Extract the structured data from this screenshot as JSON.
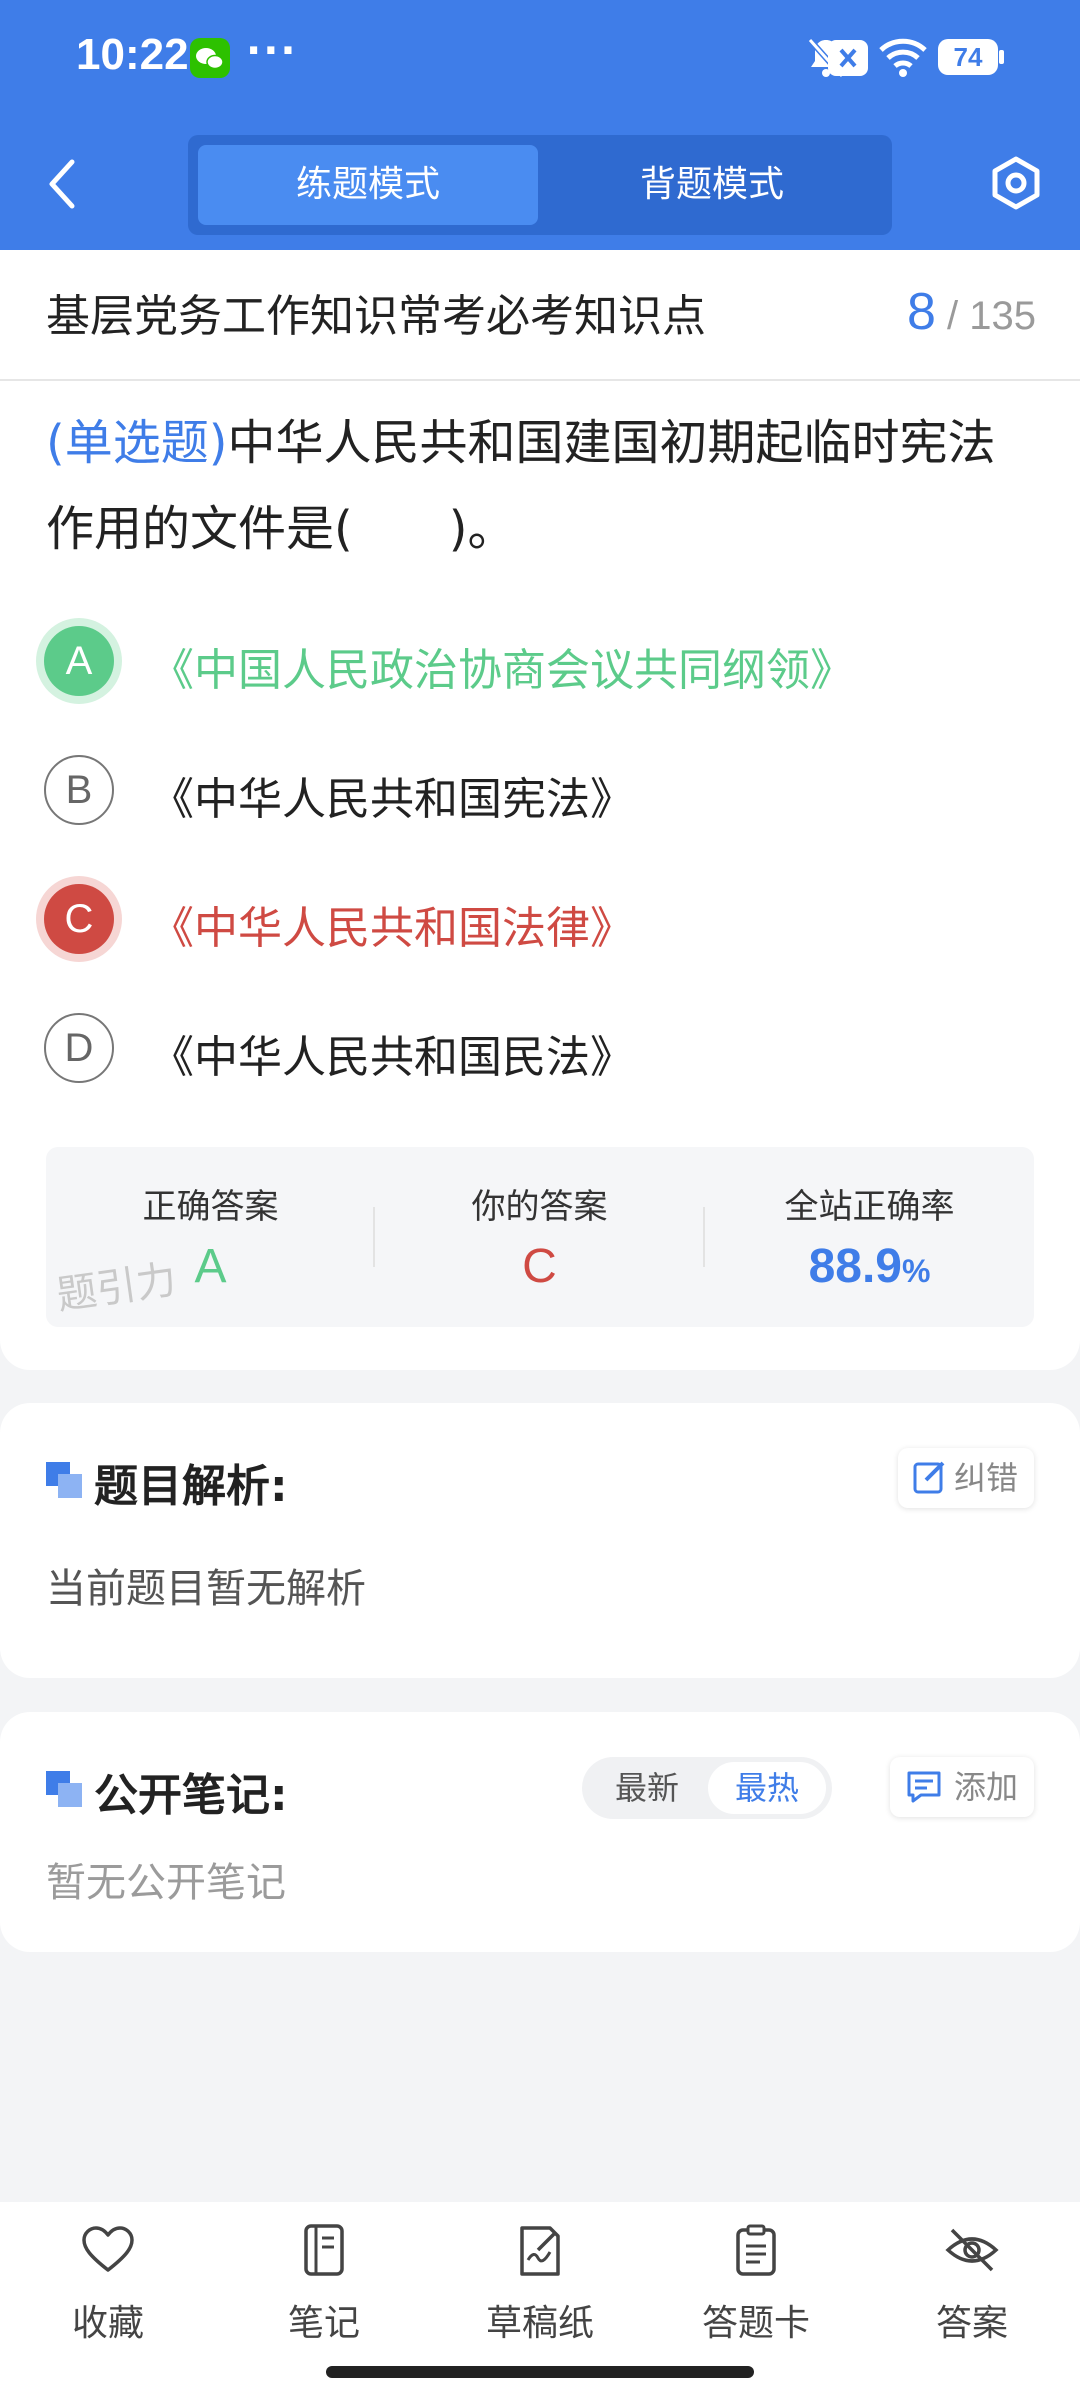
{
  "status_bar": {
    "time": "10:22",
    "dots": "···",
    "battery": "74"
  },
  "header": {
    "modes": [
      "练题模式",
      "背题模式"
    ],
    "active_mode": "练题模式"
  },
  "title_row": {
    "title": "基层党务工作知识常考必考知识点",
    "current": "8",
    "total": "/ 135"
  },
  "question": {
    "type": "(单选题)",
    "text": "中华人民共和国建国初期起临时宪法作用的文件是(　　)。",
    "options": [
      {
        "letter": "A",
        "text": "《中国人民政治协商会议共同纲领》",
        "state": "correct"
      },
      {
        "letter": "B",
        "text": "《中华人民共和国宪法》",
        "state": "normal"
      },
      {
        "letter": "C",
        "text": "《中华人民共和国法律》",
        "state": "wrong"
      },
      {
        "letter": "D",
        "text": "《中华人民共和国民法》",
        "state": "normal"
      }
    ]
  },
  "stats": {
    "correct_label": "正确答案",
    "correct_value": "A",
    "yours_label": "你的答案",
    "yours_value": "C",
    "rate_label": "全站正确率",
    "rate_value": "88.9",
    "rate_unit": "%",
    "watermark": "题引力"
  },
  "analysis": {
    "title": "题目解析:",
    "report_label": "纠错",
    "text": "当前题目暂无解析"
  },
  "notes": {
    "title": "公开笔记:",
    "sort_options": [
      "最新",
      "最热"
    ],
    "active_sort": "最热",
    "add_label": "添加",
    "empty_text": "暂无公开笔记"
  },
  "tabbar": [
    {
      "label": "收藏",
      "icon": "heart-icon"
    },
    {
      "label": "笔记",
      "icon": "notebook-icon"
    },
    {
      "label": "草稿纸",
      "icon": "draft-icon"
    },
    {
      "label": "答题卡",
      "icon": "answer-sheet-icon"
    },
    {
      "label": "答案",
      "icon": "eye-off-icon"
    }
  ],
  "colors": {
    "primary": "#3f7de8",
    "correct": "#5ccb8a",
    "wrong": "#cf4a43"
  }
}
